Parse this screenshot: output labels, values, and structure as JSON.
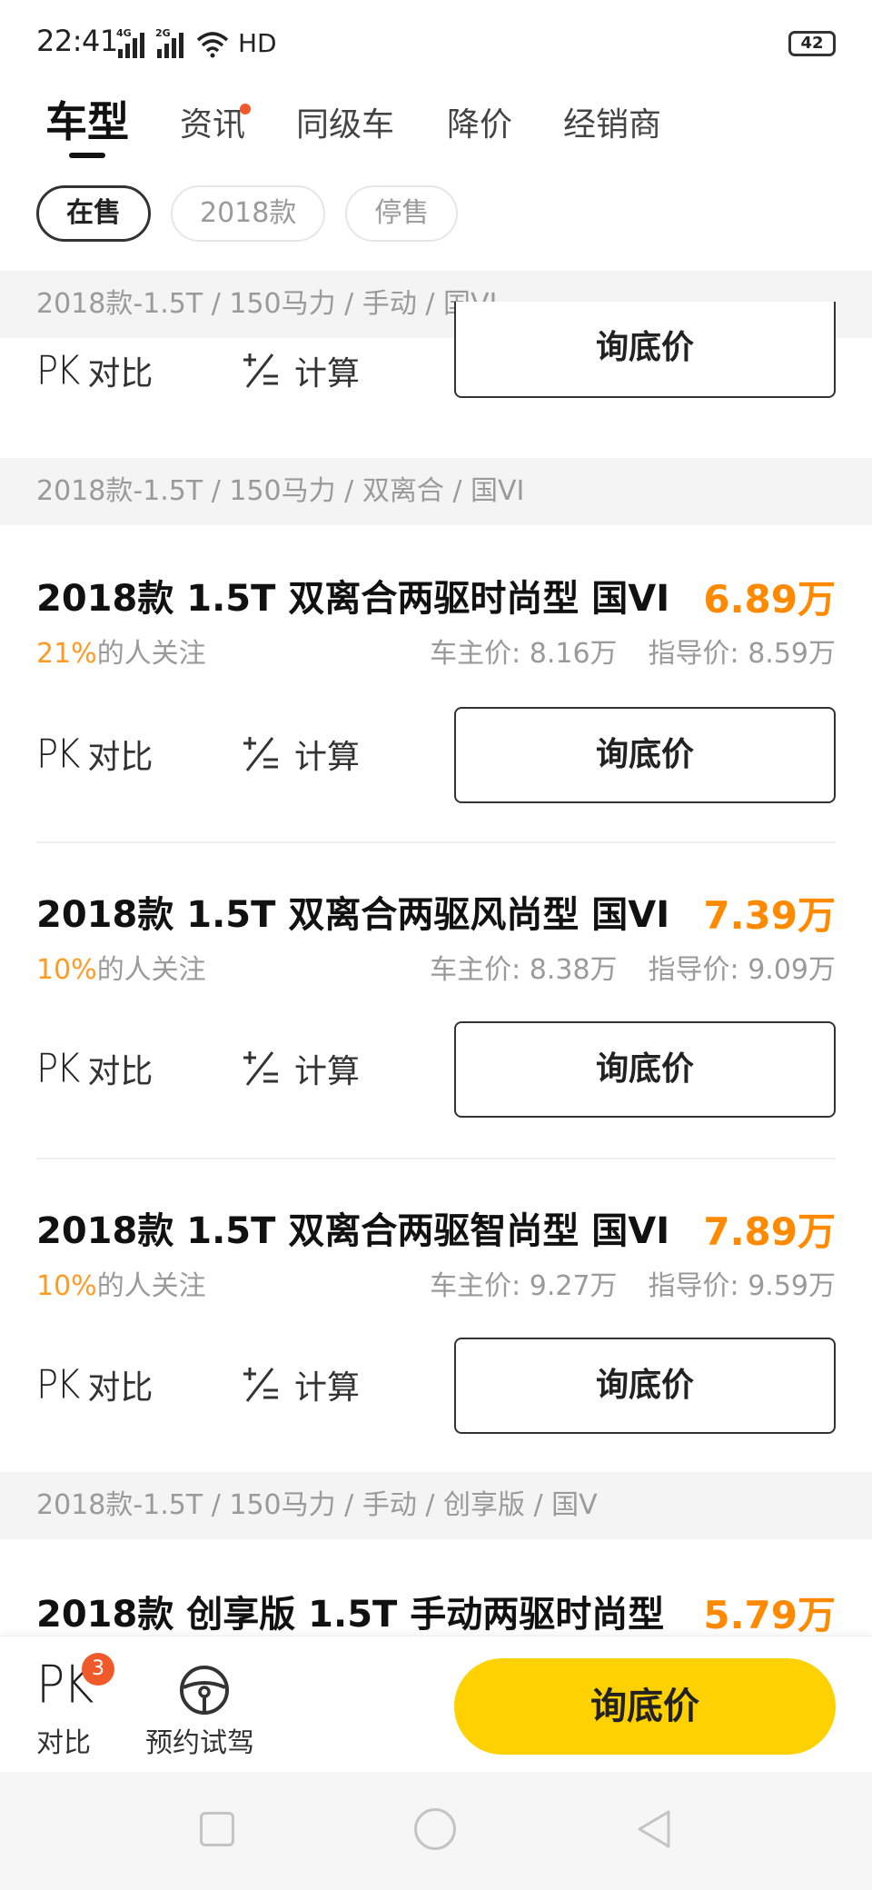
{
  "status": {
    "time": "22:41",
    "signal1_tag": "4G",
    "signal2_tag": "2G",
    "network": "HD",
    "battery": "42"
  },
  "tabs": [
    {
      "label": "车型",
      "active": true
    },
    {
      "label": "资讯",
      "has_dot": true
    },
    {
      "label": "同级车"
    },
    {
      "label": "降价"
    },
    {
      "label": "经销商"
    }
  ],
  "filters": [
    {
      "label": "在售",
      "active": true
    },
    {
      "label": "2018款"
    },
    {
      "label": "停售"
    }
  ],
  "groups": [
    "2018款-1.5T / 150马力 / 手动 / 国VI",
    "2018款-1.5T / 150马力 / 双离合 / 国VI",
    "2018款-1.5T / 150马力 / 手动 / 创享版 / 国V"
  ],
  "actions": {
    "pk_glyph": "PK",
    "compare": "对比",
    "calc": "计算",
    "ask_price": "询底价"
  },
  "cars": [
    {
      "title": "2018款 1.5T 双离合两驱时尚型 国VI",
      "price": "6.89万",
      "attention_pct": "21%",
      "attention_suffix": "的人关注",
      "owner_price": "车主价: 8.16万",
      "guide_price": "指导价: 8.59万"
    },
    {
      "title": "2018款 1.5T 双离合两驱风尚型 国VI",
      "price": "7.39万",
      "attention_pct": "10%",
      "attention_suffix": "的人关注",
      "owner_price": "车主价: 8.38万",
      "guide_price": "指导价: 9.09万"
    },
    {
      "title": "2018款 1.5T 双离合两驱智尚型 国VI",
      "price": "7.89万",
      "attention_pct": "10%",
      "attention_suffix": "的人关注",
      "owner_price": "车主价: 9.27万",
      "guide_price": "指导价: 9.59万"
    },
    {
      "title": "2018款 创享版 1.5T 手动两驱时尚型",
      "price": "5.79万"
    }
  ],
  "bottom": {
    "pk_glyph": "PK",
    "compare_badge": "3",
    "compare_label": "对比",
    "test_drive_label": "预约试驾",
    "ask_price": "询底价"
  },
  "colors": {
    "accent_orange": "#ff8a00",
    "cta_yellow": "#ffd100",
    "badge_red": "#f05a2a"
  }
}
